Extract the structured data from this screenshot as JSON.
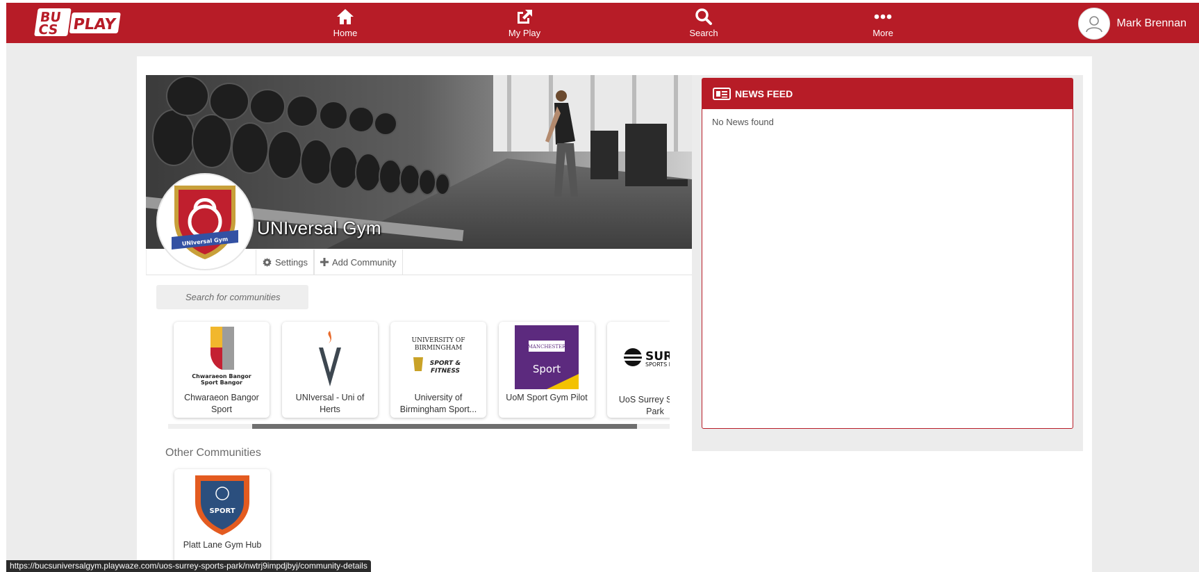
{
  "brand": {
    "logo_text_top": "BU",
    "logo_text_bottom": "CS",
    "logo_text_play": "PLAY",
    "accent": "#b71c27"
  },
  "nav": {
    "items": [
      {
        "label": "Home",
        "icon": "home-icon"
      },
      {
        "label": "My Play",
        "icon": "external-link-icon"
      },
      {
        "label": "Search",
        "icon": "search-icon"
      },
      {
        "label": "More",
        "icon": "more-dots-icon"
      }
    ],
    "user_name": "Mark Brennan"
  },
  "community": {
    "title": "UNIversal Gym",
    "logo_text": "UNIversal Gym",
    "actions": {
      "settings": "Settings",
      "add_community": "Add Community"
    }
  },
  "search": {
    "placeholder": "Search for communities"
  },
  "communities": [
    {
      "name": "Chwaraeon Bangor Sport",
      "logo_text": "Chwaraeon Bangor Sport Bangor"
    },
    {
      "name": "UNIversal - Uni of Herts",
      "logo_text": ""
    },
    {
      "name": "University of Birmingham Sport...",
      "logo_text": "UNIVERSITY OF BIRMINGHAM SPORT & FITNESS"
    },
    {
      "name": "UoM Sport Gym Pilot",
      "logo_text": "Sport"
    },
    {
      "name": "UoS Surrey Sports Park",
      "logo_text": "SURREY SPORTS PARK"
    }
  ],
  "other_communities": {
    "title": "Other Communities",
    "items": [
      {
        "name": "Platt Lane Gym Hub",
        "logo_text": "SPORT"
      }
    ]
  },
  "news_feed": {
    "title": "NEWS FEED",
    "empty_text": "No News found"
  },
  "status_bar": {
    "url": "https://bucsuniversalgym.playwaze.com/uos-surrey-sports-park/nwtrj9impdjbyj/community-details"
  }
}
